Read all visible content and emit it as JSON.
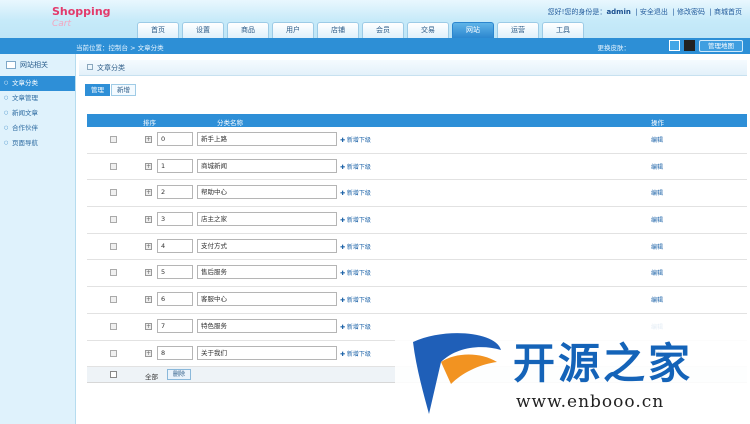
{
  "app": {
    "logo_text": "Shopping",
    "logo_sub": "Cart"
  },
  "header": {
    "user_greeting": "您好!您的身份是：",
    "user_name": "admin",
    "links": [
      "安全退出",
      "修改密码",
      "商城首页"
    ]
  },
  "nav": {
    "tabs": [
      "首页",
      "设置",
      "商品",
      "用户",
      "店铺",
      "会员",
      "交易",
      "网站",
      "运营",
      "工具"
    ],
    "active_index": 7
  },
  "bar": {
    "breadcrumb": "当前位置：控制台 > 文章分类",
    "switch_label": "更换皮肤：",
    "map_button": "管理地图"
  },
  "sidebar": {
    "title": "网站相关",
    "items": [
      "文章分类",
      "文章管理",
      "新闻文章",
      "合作伙伴",
      "页面导航"
    ],
    "active_index": 0
  },
  "main": {
    "panel_title": "文章分类",
    "tabs": [
      "管理",
      "新增"
    ],
    "columns": {
      "sort": "排序",
      "name": "分类名称",
      "action": "操作"
    },
    "add_sub_label": "新增下级",
    "edit_label": "编辑",
    "rows": [
      {
        "sort": "0",
        "name": "新手上路"
      },
      {
        "sort": "1",
        "name": "商城新闻"
      },
      {
        "sort": "2",
        "name": "帮助中心"
      },
      {
        "sort": "3",
        "name": "店主之家"
      },
      {
        "sort": "4",
        "name": "支付方式"
      },
      {
        "sort": "5",
        "name": "售后服务"
      },
      {
        "sort": "6",
        "name": "客服中心"
      },
      {
        "sort": "7",
        "name": "特色服务"
      },
      {
        "sort": "8",
        "name": "关于我们"
      }
    ],
    "footer": {
      "select_all": "全部",
      "delete_button": "删除"
    }
  },
  "watermark": {
    "title": "开源之家",
    "url": "www.enbooo.cn"
  }
}
